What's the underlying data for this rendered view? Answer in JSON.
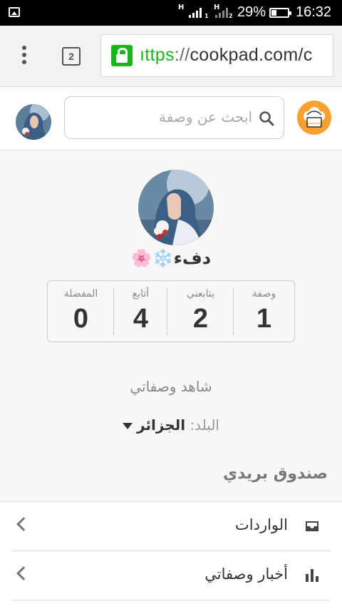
{
  "status_bar": {
    "network_1": "H",
    "network_2": "H",
    "sim_1": "1",
    "sim_2": "2",
    "battery": "29%",
    "time": "16:32"
  },
  "browser": {
    "tab_count": "2",
    "url_scheme": "ıttps",
    "url_separator": "://",
    "url_host": "cookpad.com/c"
  },
  "header": {
    "search_placeholder": "ابحث عن وصفة",
    "search_icon": "magnifier",
    "logo_icon": "chef-hat"
  },
  "profile": {
    "name": "دفء",
    "name_emoji": "❄️🌸",
    "stats": [
      {
        "label": "وصفة",
        "value": "1"
      },
      {
        "label": "يتابعني",
        "value": "2"
      },
      {
        "label": "أتابع",
        "value": "4"
      },
      {
        "label": "المفضلة",
        "value": "0"
      }
    ],
    "watch_recipes": "شاهد وصفاتي",
    "country_label": "البلد:",
    "country_value": "الجزائر"
  },
  "mailbox": {
    "title": "صندوق بريدي",
    "items": [
      {
        "label": "الواردات",
        "icon": "inbox-icon"
      },
      {
        "label": "أخبار وصفاتي",
        "icon": "bar-chart-icon"
      }
    ]
  },
  "colors": {
    "brand_orange": "#f9a033",
    "secure_green": "#1bb51b",
    "status_bar": "#000000"
  }
}
